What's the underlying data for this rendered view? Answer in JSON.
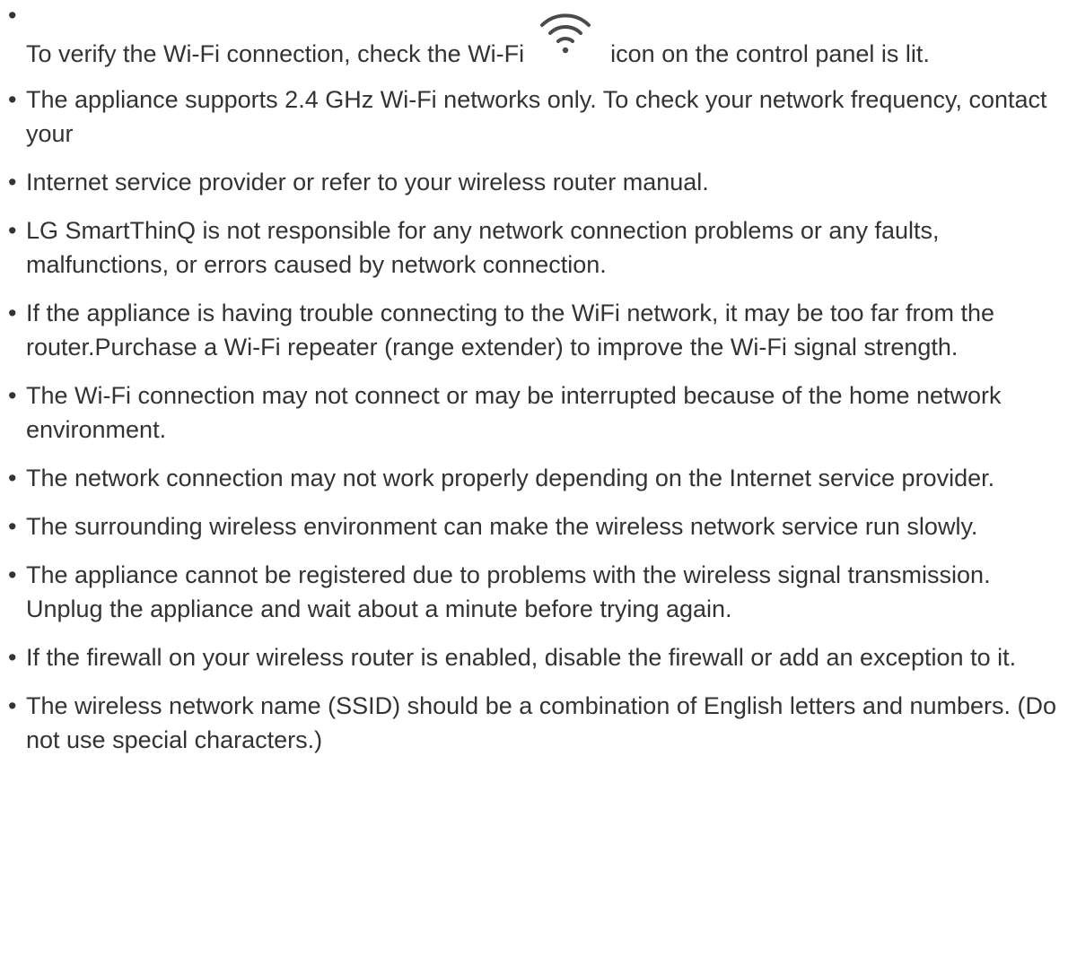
{
  "bullet_char": "•",
  "first_item": {
    "before_icon": "To verify the Wi-Fi connection, check the Wi-Fi",
    "icon": "wifi-icon",
    "after_icon": "icon on the control panel is lit."
  },
  "items": [
    {
      "text": "The appliance supports 2.4 GHz Wi-Fi networks only. To check your network frequency, contact your"
    },
    {
      "text": "Internet service provider or refer to your wireless router manual."
    },
    {
      "text": "LG SmartThinQ is not responsible for any network connection problems or any faults, malfunctions, or errors caused by network connection."
    },
    {
      "text": "If the appliance is having trouble connecting to the WiFi network, it may be too far from the router.Purchase a Wi-Fi repeater (range extender) to improve the Wi-Fi signal strength."
    },
    {
      "text": "The Wi-Fi connection may not connect or may be interrupted because of the home network environment."
    },
    {
      "text": "The network connection may not work properly depending on the Internet service provider."
    },
    {
      "text": "The surrounding wireless environment can make the wireless network service run slowly."
    },
    {
      "text": "The appliance cannot be registered due to problems with the wireless signal transmission. Unplug the appliance and wait about a minute before trying again."
    },
    {
      "text": "If the firewall on your wireless router is enabled, disable the firewall or add an exception to it."
    },
    {
      "text": "The wireless network name (SSID) should be a combination of English letters and numbers. (Do not use special characters.)"
    }
  ],
  "colors": {
    "text": "#333333",
    "icon": "#4a4a4a",
    "background": "#ffffff"
  }
}
